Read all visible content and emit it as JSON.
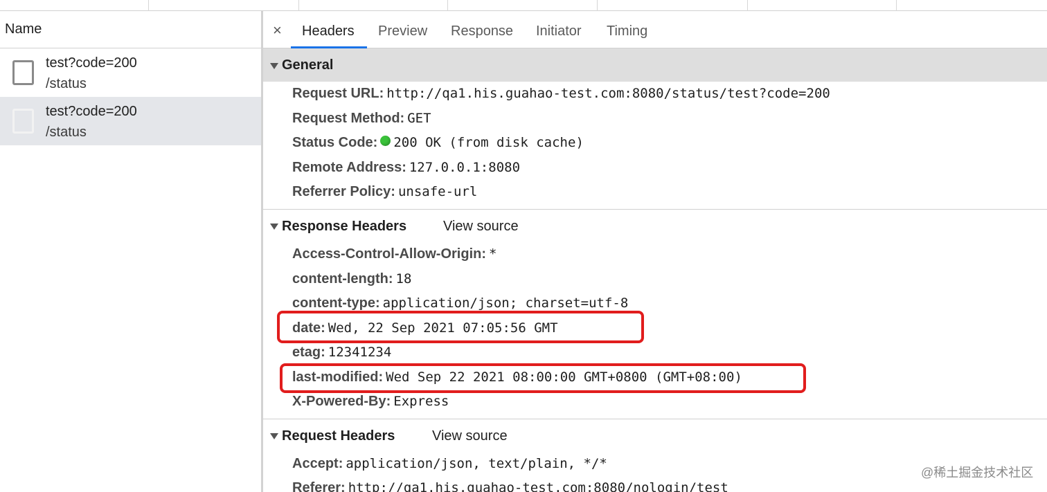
{
  "left_pane": {
    "header": "Name",
    "requests": [
      {
        "name": "test?code=200",
        "path": "/status",
        "selected": false
      },
      {
        "name": "test?code=200",
        "path": "/status",
        "selected": true
      }
    ]
  },
  "tabs": {
    "close_glyph": "×",
    "items": [
      "Headers",
      "Preview",
      "Response",
      "Initiator",
      "Timing"
    ],
    "active": "Headers"
  },
  "general": {
    "title": "General",
    "rows": [
      {
        "key": "Request URL:",
        "value": "http://qa1.his.guahao-test.com:8080/status/test?code=200"
      },
      {
        "key": "Request Method:",
        "value": "GET"
      },
      {
        "key": "Status Code:",
        "value": "200 OK (from disk cache)",
        "status_color": "#3ac23a"
      },
      {
        "key": "Remote Address:",
        "value": "127.0.0.1:8080"
      },
      {
        "key": "Referrer Policy:",
        "value": "unsafe-url"
      }
    ]
  },
  "response_headers": {
    "title": "Response Headers",
    "view_source": "View source",
    "rows": [
      {
        "key": "Access-Control-Allow-Origin:",
        "value": "*"
      },
      {
        "key": "content-length:",
        "value": "18"
      },
      {
        "key": "content-type:",
        "value": "application/json; charset=utf-8"
      },
      {
        "key": "date:",
        "value": "Wed, 22 Sep 2021 07:05:56 GMT"
      },
      {
        "key": "etag:",
        "value": "12341234"
      },
      {
        "key": "last-modified:",
        "value": "Wed Sep 22 2021 08:00:00 GMT+0800 (GMT+08:00)"
      },
      {
        "key": "X-Powered-By:",
        "value": "Express"
      }
    ]
  },
  "request_headers": {
    "title": "Request Headers",
    "view_source": "View source",
    "rows": [
      {
        "key": "Accept:",
        "value": "application/json, text/plain, */*"
      },
      {
        "key": "Referer:",
        "value": "http://qa1.his.guahao-test.com:8080/nologin/test"
      }
    ]
  },
  "annotations": {
    "highlight_color": "#e11d1d"
  },
  "watermark": "@稀土掘金技术社区"
}
